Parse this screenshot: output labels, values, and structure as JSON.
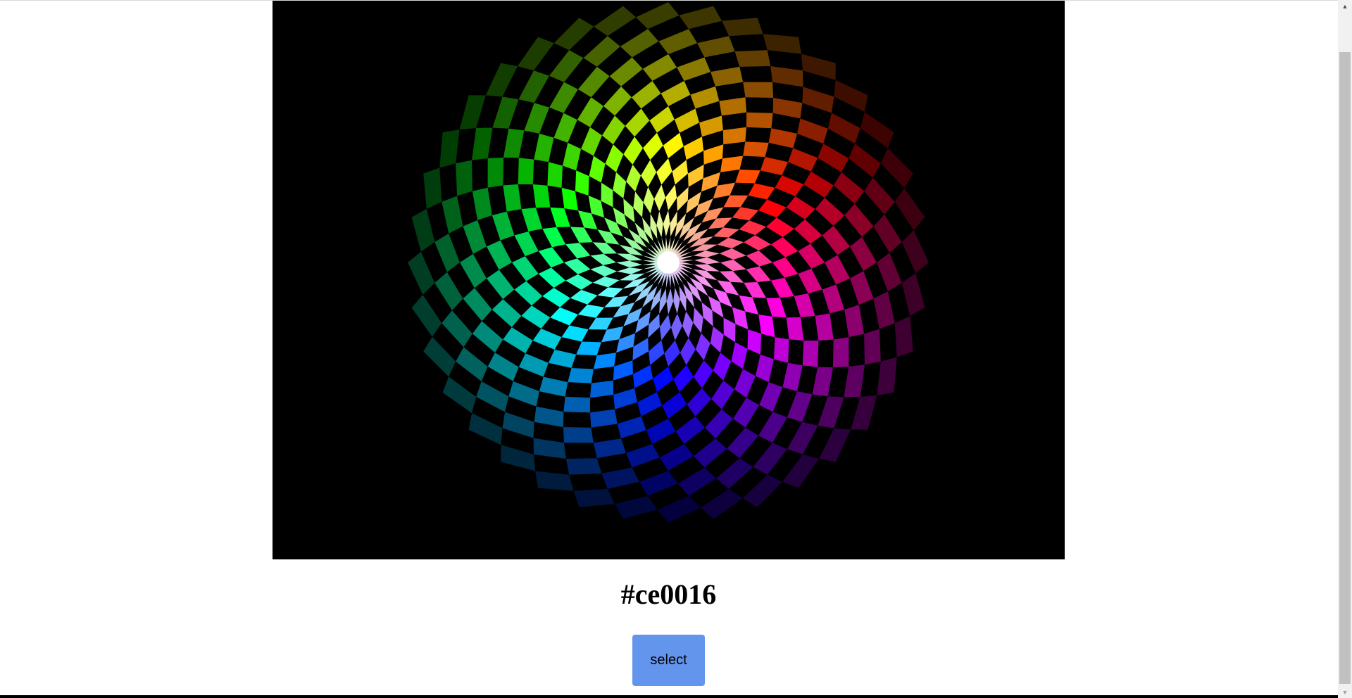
{
  "color_picker": {
    "selected_hex": "#ce0016",
    "select_label": "select"
  },
  "colors": {
    "button_background": "#6495ed",
    "image_background": "#000000",
    "scrollbar_track": "#f1f1f1",
    "scrollbar_thumb": "#c1c1c1"
  },
  "icons": {
    "scroll_up": "triangle-up-icon",
    "scroll_down": "triangle-down-icon"
  },
  "scroll": {
    "position_fraction": 0.07
  }
}
